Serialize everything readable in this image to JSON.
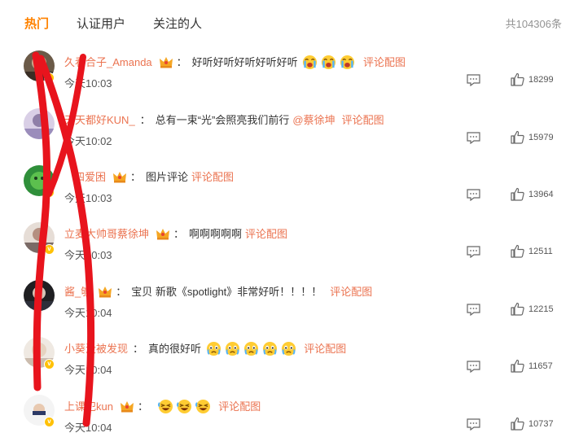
{
  "tabs": {
    "hot": "热门",
    "verified": "认证用户",
    "following": "关注的人"
  },
  "total": "共104306条",
  "colors": {
    "accent": "#ff8200",
    "link": "#eb7350",
    "annotation_stroke": "#e8141d"
  },
  "comments": [
    {
      "user": "久看合子_Amanda",
      "text": "好听好听好听好听好听",
      "link": "评论配图",
      "time": "今天10:03",
      "likes": "18299",
      "has_crown": true,
      "emojis": [
        "crying-face-emoji",
        "crying-face-emoji",
        "crying-face-emoji"
      ]
    },
    {
      "user": "天天都好KUN_",
      "text": "总有一束“光”会照亮我们前行",
      "mention": "@蔡徐坤",
      "link": "评论配图",
      "time": "今天10:02",
      "likes": "15979",
      "has_crown": false
    },
    {
      "user": "四爱困",
      "text": "图片评论",
      "link": "评论配图",
      "time": "今天10:03",
      "likes": "13964",
      "has_crown": true
    },
    {
      "user": "立麦大帅哥蔡徐坤",
      "text": "啊啊啊啊啊",
      "link": "评论配图",
      "time": "今天10:03",
      "likes": "12511",
      "has_crown": true
    },
    {
      "user": "酱_够",
      "text": "宝贝 新歌《spotlight》非常好听！！！！",
      "link": "评论配图",
      "time": "今天10:04",
      "likes": "12215",
      "has_crown": true
    },
    {
      "user": "小葵没被发现",
      "text": "真的很好听",
      "link": "评论配图",
      "time": "今天10:04",
      "likes": "11657",
      "has_crown": true,
      "emojis": [
        "tearful-face-emoji",
        "tearful-face-emoji",
        "tearful-face-emoji",
        "tearful-face-emoji",
        "tearful-face-emoji"
      ]
    },
    {
      "user": "上课犯kun",
      "text": "",
      "link": "评论配图",
      "time": "今天10:04",
      "likes": "10737",
      "has_crown": true,
      "emojis": [
        "laughing-face-emoji",
        "laughing-face-emoji",
        "laughing-face-emoji"
      ]
    }
  ]
}
